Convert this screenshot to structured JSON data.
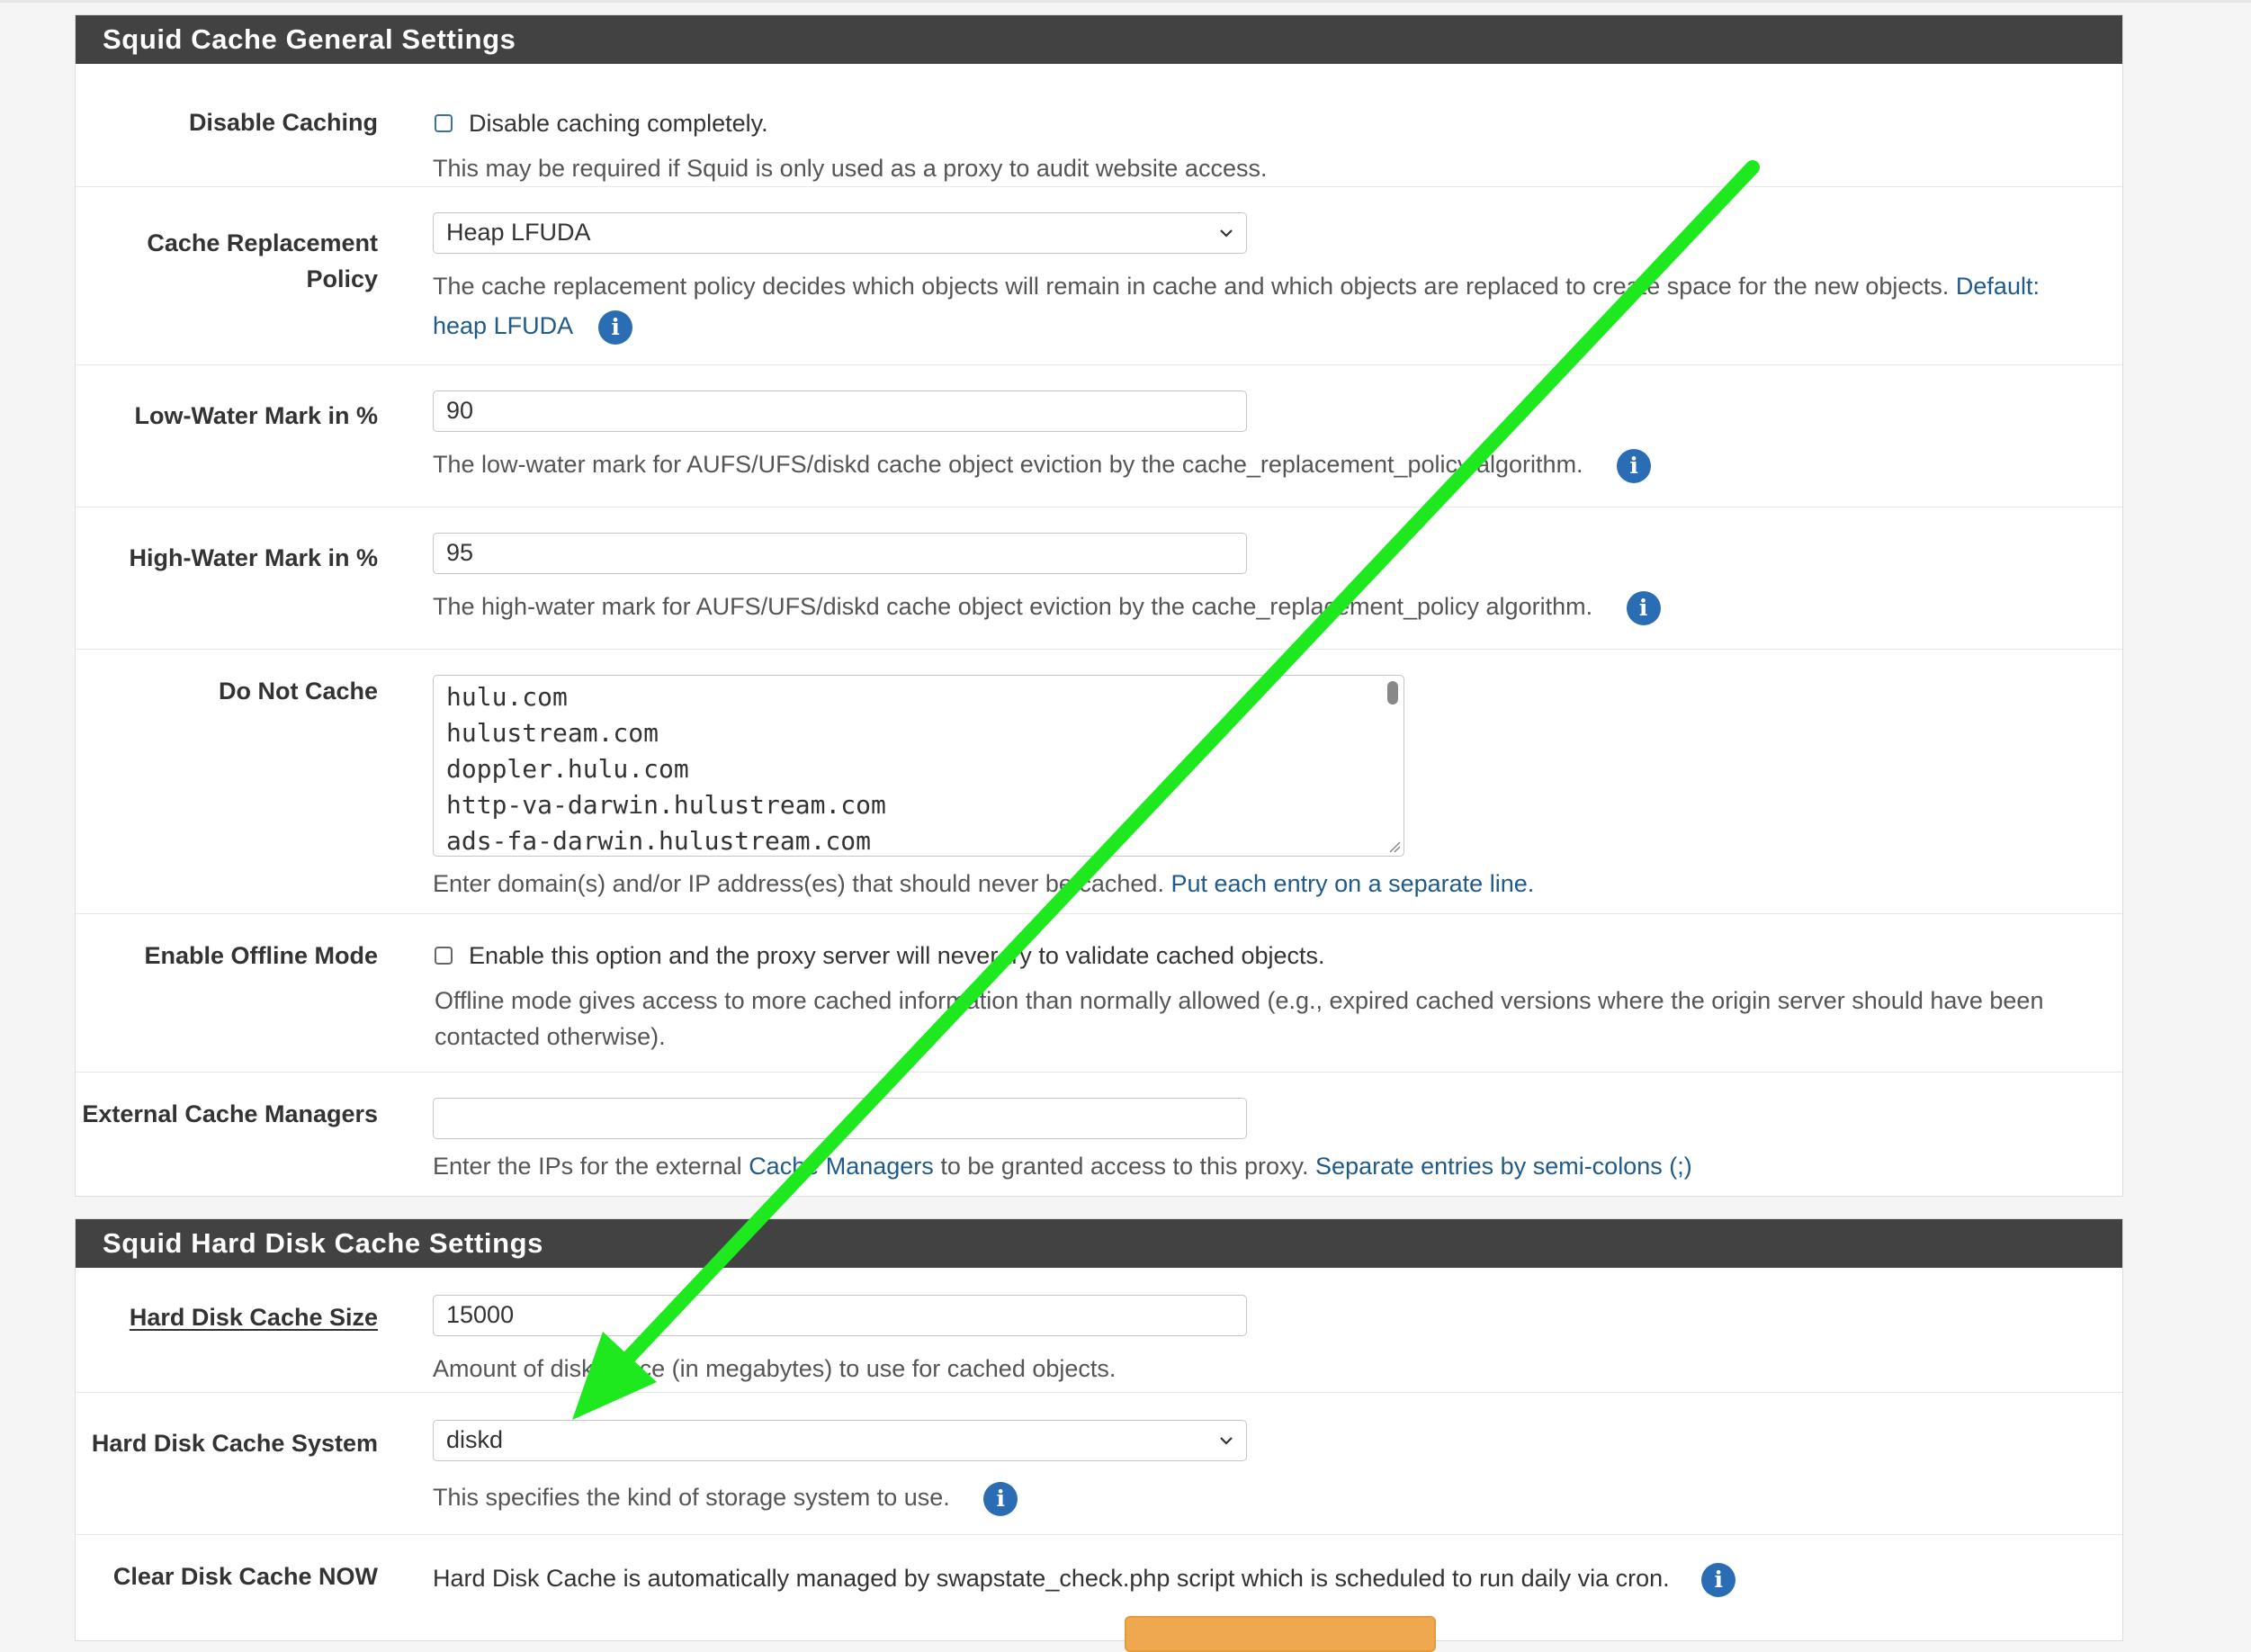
{
  "general": {
    "heading": "Squid Cache General Settings",
    "disable_caching": {
      "label": "Disable Caching",
      "checkbox_text": "Disable caching completely.",
      "checked": false,
      "help": "This may be required if Squid is only used as a proxy to audit website access."
    },
    "replacement_policy": {
      "label_line1": "Cache Replacement",
      "label_line2": "Policy",
      "value": "Heap LFUDA",
      "help": "The cache replacement policy decides which objects will remain in cache and which objects are replaced to create space for the new objects. ",
      "default_label": "Default:",
      "default_value": "heap LFUDA"
    },
    "low_water": {
      "label": "Low-Water Mark in %",
      "value": "90",
      "help": "The low-water mark for AUFS/UFS/diskd cache object eviction by the cache_replacement_policy algorithm."
    },
    "high_water": {
      "label": "High-Water Mark in %",
      "value": "95",
      "help": "The high-water mark for AUFS/UFS/diskd cache object eviction by the cache_replacement_policy algorithm."
    },
    "do_not_cache": {
      "label": "Do Not Cache",
      "entries": [
        "hulu.com",
        "hulustream.com",
        "doppler.hulu.com",
        "http-va-darwin.hulustream.com",
        "ads-fa-darwin.hulustream.com"
      ],
      "help": "Enter domain(s) and/or IP address(es) that should never be cached. ",
      "help_link": "Put each entry on a separate line."
    },
    "offline_mode": {
      "label": "Enable Offline Mode",
      "checkbox_text": "Enable this option and the proxy server will never try to validate cached objects.",
      "checked": false,
      "help_line1": "Offline mode gives access to more cached information than normally allowed (e.g., expired cached versions where the origin server should have been",
      "help_line2": "contacted otherwise)."
    },
    "external_managers": {
      "label": "External Cache Managers",
      "value": "",
      "help_pre": "Enter the IPs for the external ",
      "help_link1": "Cache Managers",
      "help_mid": " to be granted access to this proxy. ",
      "help_link2": "Separate entries by semi-colons (;)"
    }
  },
  "hard_disk": {
    "heading": "Squid Hard Disk Cache Settings",
    "cache_size": {
      "label": "Hard Disk Cache Size",
      "value": "15000",
      "help": "Amount of disk space (in megabytes) to use for cached objects."
    },
    "cache_system": {
      "label": "Hard Disk Cache System",
      "value": "diskd",
      "help": "This specifies the kind of storage system to use."
    },
    "clear_cache": {
      "label": "Clear Disk Cache NOW",
      "text": "Hard Disk Cache is automatically managed by swapstate_check.php script which is scheduled to run daily via cron."
    }
  },
  "annotation": {
    "arrow_color": "#1ee81e"
  },
  "colors": {
    "heading_bg": "#424242",
    "link": "#1f5a8a",
    "info_icon": "#2a6db5"
  }
}
